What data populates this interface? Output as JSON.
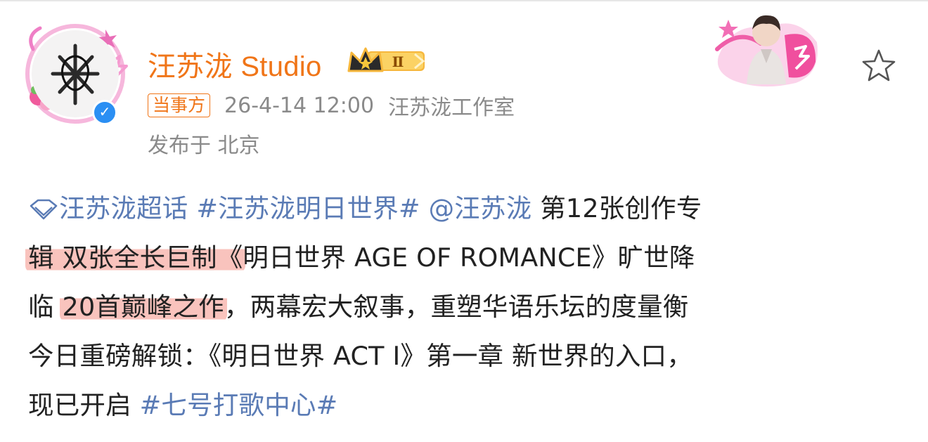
{
  "header": {
    "username": "汪苏泷 Studio",
    "vip_level": "Ⅱ",
    "party_tag": "当事方",
    "timestamp": "26-4-14 12:00",
    "source": "汪苏泷工作室",
    "location": "发布于 北京"
  },
  "icons": {
    "avatar": "avatar-image",
    "verified": "verified-badge-icon",
    "vip": "crown-vip-badge-icon",
    "decor": "decorative-card-icon",
    "favorite": "star-outline-icon",
    "topic": "super-topic-diamond-icon"
  },
  "colors": {
    "username": "#f07518",
    "link": "#5a7bb5",
    "meta": "#8a8a8a",
    "highlight": "#f9c3bd",
    "verified": "#2b8ff3"
  },
  "post": {
    "supertopic": "汪苏泷超话",
    "hashtag1": "#汪苏泷明日世界#",
    "mention": "@汪苏泷",
    "l1_text": " 第12张创作专",
    "l2_hl": "辑 双张全长巨制《",
    "l2_text": "明日世界 AGE OF ROMANCE》旷世降",
    "l3_a": "临 ",
    "l3_hl": "20首巅峰之作",
    "l3_b": "，两幕宏大叙事，重塑华语乐坛的度量衡",
    "l4": "今日重磅解锁：《明日世界 ACT I》第一章 新世界的入口，",
    "l5_text": "现已开启 ",
    "hashtag2": "#七号打歌中心#"
  }
}
